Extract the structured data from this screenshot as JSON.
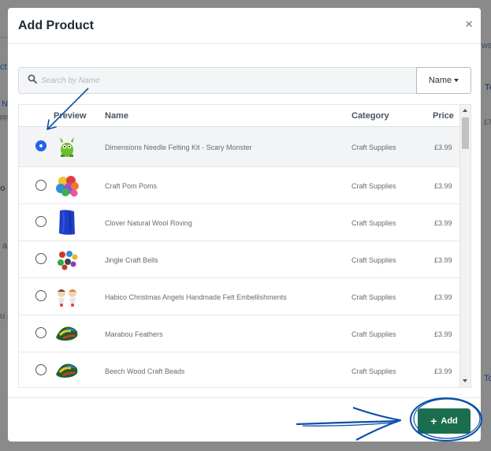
{
  "background": {
    "frag_left_1": "ct",
    "frag_left_2": "N",
    "frag_left_3": "pp",
    "frag_left_4": "o",
    "frag_left_5": "a",
    "frag_left_6": "u p",
    "frag_right_1": "ws",
    "frag_right_2": "To",
    "frag_right_3": "£7",
    "frag_right_4": "To"
  },
  "modal": {
    "title": "Add Product",
    "close_glyph": "×",
    "search": {
      "placeholder": "Search by Name",
      "value": ""
    },
    "filter_dropdown": {
      "selected": "Name"
    },
    "table": {
      "headers": {
        "preview": "Preview",
        "name": "Name",
        "category": "Category",
        "price": "Price"
      },
      "rows": [
        {
          "selected": true,
          "name": "Dimensions Needle Felting Kit - Scary Monster",
          "category": "Craft Supplies",
          "price": "£3.99",
          "thumb": "green-monster-image"
        },
        {
          "selected": false,
          "name": "Craft Pom Poms",
          "category": "Craft Supplies",
          "price": "£3.99",
          "thumb": "pom-poms-image"
        },
        {
          "selected": false,
          "name": "Clover Natural Wool Roving",
          "category": "Craft Supplies",
          "price": "£3.99",
          "thumb": "blue-wool-image"
        },
        {
          "selected": false,
          "name": "Jingle Craft Bells",
          "category": "Craft Supplies",
          "price": "£3.99",
          "thumb": "bells-image"
        },
        {
          "selected": false,
          "name": "Habico Christmas Angels Handmade Felt Embellishments",
          "category": "Craft Supplies",
          "price": "£3.99",
          "thumb": "felt-angels-image"
        },
        {
          "selected": false,
          "name": "Marabou Feathers",
          "category": "Craft Supplies",
          "price": "£3.99",
          "thumb": "feathers-image"
        },
        {
          "selected": false,
          "name": "Beech Wood Craft Beads",
          "category": "Craft Supplies",
          "price": "£3.99",
          "thumb": "beads-image"
        }
      ]
    },
    "footer": {
      "add_label": "Add",
      "add_icon": "plus-icon"
    }
  },
  "colors": {
    "primary_button": "#1a6e4f",
    "radio_checked": "#2563eb",
    "annotation": "#0b4fa8"
  }
}
